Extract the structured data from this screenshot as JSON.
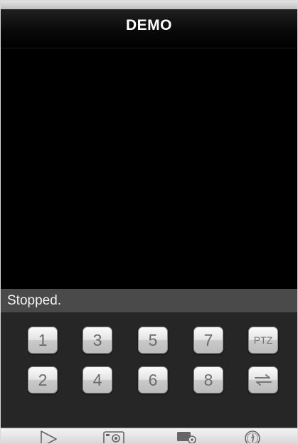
{
  "header": {
    "title": "DEMO"
  },
  "status": {
    "text": "Stopped."
  },
  "channels": {
    "top": [
      "1",
      "3",
      "5",
      "7"
    ],
    "bottom": [
      "2",
      "4",
      "6",
      "8"
    ],
    "ptz_label": "PTZ"
  },
  "toolbar_icons": [
    "play-icon",
    "snapshot-camera-icon",
    "device-settings-icon",
    "info-icon"
  ],
  "colors": {
    "background": "#000000",
    "status_bar": "#4a4a4a",
    "control_panel": "#262626",
    "key_text": "#6b6b6b"
  }
}
